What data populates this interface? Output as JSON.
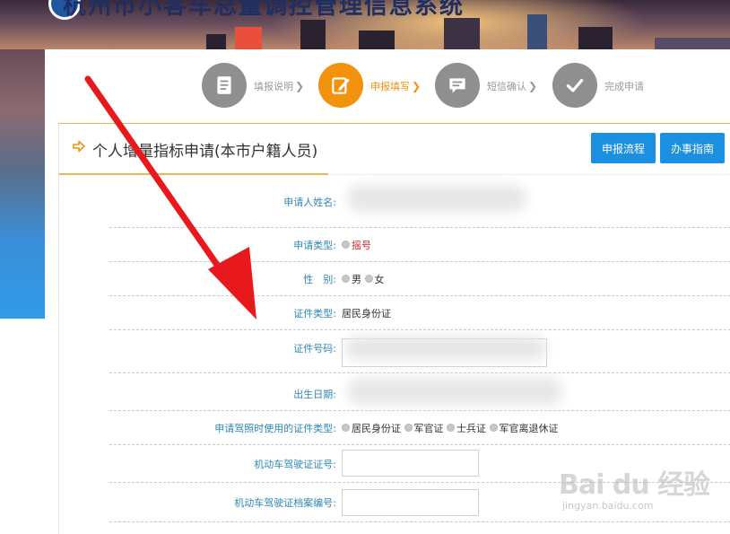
{
  "banner": {
    "title": "杭州市小客车总量调控管理信息系统"
  },
  "steps": [
    {
      "label": "填报说明",
      "icon": "document-icon",
      "state": "done"
    },
    {
      "label": "申报填写",
      "icon": "edit-icon",
      "state": "active"
    },
    {
      "label": "短信确认",
      "icon": "message-icon",
      "state": "pending"
    },
    {
      "label": "完成申请",
      "icon": "check-icon",
      "state": "pending"
    }
  ],
  "form": {
    "title": "个人增量指标申请(本市户籍人员)",
    "buttons": {
      "process": "申报流程",
      "guide": "办事指南"
    },
    "rows": {
      "name": {
        "label": "申请人姓名:"
      },
      "type": {
        "label": "申请类型:",
        "option": "摇号"
      },
      "gender": {
        "label": "性　别:",
        "options": [
          "男",
          "女"
        ]
      },
      "id_type": {
        "label": "证件类型:",
        "value": "居民身份证"
      },
      "id_number": {
        "label": "证件号码:"
      },
      "birth": {
        "label": "出生日期:"
      },
      "license_id_type": {
        "label": "申请驾照时使用的证件类型:",
        "options": [
          "居民身份证",
          "军官证",
          "士兵证",
          "军官离退休证"
        ]
      },
      "license_no": {
        "label": "机动车驾驶证证号:"
      },
      "archive_no": {
        "label": "机动车驾驶证档案编号:"
      }
    }
  },
  "watermark": {
    "logo": "Bai du 经验",
    "sub": "jingyan.baidu.com"
  },
  "colors": {
    "accent_orange": "#f2920d",
    "button_blue": "#1b8fe0",
    "label_blue": "#2e87b4",
    "arrow_red": "#e8191c"
  }
}
